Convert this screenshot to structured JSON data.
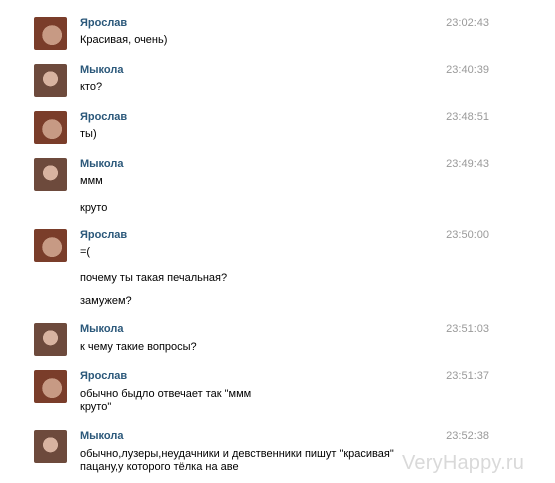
{
  "messages": [
    {
      "author": "Ярослав",
      "time": "23:02:43",
      "lines": [
        "Красивая, очень)"
      ]
    },
    {
      "author": "Мыкола",
      "time": "23:40:39",
      "lines": [
        "кто?"
      ]
    },
    {
      "author": "Ярослав",
      "time": "23:48:51",
      "lines": [
        "ты)"
      ]
    },
    {
      "author": "Мыкола",
      "time": "23:49:43",
      "lines": [
        "ммм",
        "круто"
      ]
    },
    {
      "author": "Ярослав",
      "time": "23:50:00",
      "lines": [
        "=(",
        "почему ты такая печальная?",
        "замужем?"
      ]
    },
    {
      "author": "Мыкола",
      "time": "23:51:03",
      "lines": [
        "к чему такие вопросы?"
      ]
    },
    {
      "author": "Ярослав",
      "time": "23:51:37",
      "lines": [
        "обычно быдло отвечает так \"ммм",
        "круто\""
      ]
    },
    {
      "author": "Мыкола",
      "time": "23:52:38",
      "lines": [
        "обычно,лузеры,неудачники и девственники пишут \"красивая\"",
        "пацану,у которого тёлка на аве"
      ]
    }
  ],
  "watermark": "VeryHappy.ru"
}
